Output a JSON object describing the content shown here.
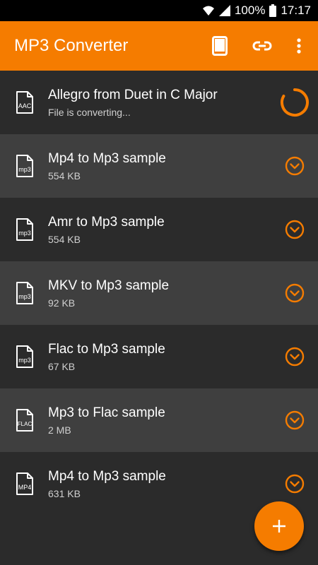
{
  "status_bar": {
    "battery": "100%",
    "time": "17:17"
  },
  "app_bar": {
    "title": "MP3 Converter"
  },
  "files": [
    {
      "name": "Allegro from Duet in C Major",
      "subtitle": "File is converting...",
      "format": "AAC",
      "state": "converting"
    },
    {
      "name": "Mp4 to Mp3 sample",
      "subtitle": "554 KB",
      "format": "mp3",
      "state": "done"
    },
    {
      "name": "Amr to Mp3 sample",
      "subtitle": "554 KB",
      "format": "mp3",
      "state": "done"
    },
    {
      "name": "MKV to Mp3 sample",
      "subtitle": "92 KB",
      "format": "mp3",
      "state": "done"
    },
    {
      "name": "Flac to Mp3 sample",
      "subtitle": "67 KB",
      "format": "mp3",
      "state": "done"
    },
    {
      "name": "Mp3 to Flac sample",
      "subtitle": "2 MB",
      "format": "FLAC",
      "state": "done"
    },
    {
      "name": "Mp4 to Mp3 sample",
      "subtitle": "631 KB",
      "format": "MP4",
      "state": "done"
    }
  ],
  "colors": {
    "accent": "#f57c00",
    "background": "#2b2b2b",
    "row_alt": "#3f3f3f"
  },
  "icons": {
    "app_bar": [
      "phone-icon",
      "link-icon",
      "more-vert-icon"
    ],
    "row_action": "chevron-down-circle-icon",
    "converting": "progress-spinner-icon",
    "fab": "plus-icon"
  }
}
